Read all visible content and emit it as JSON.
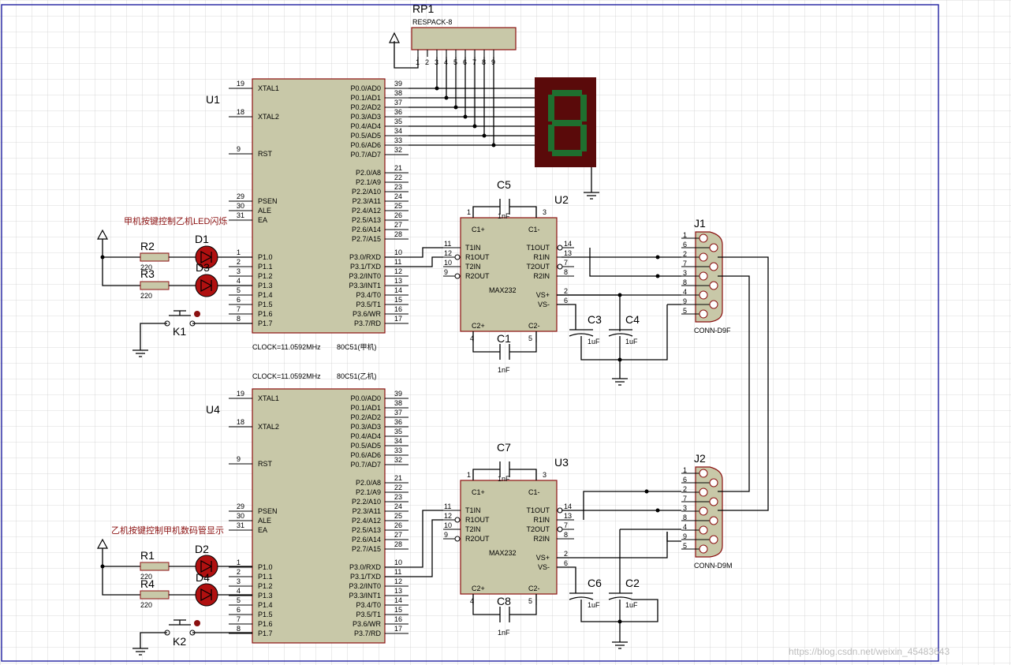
{
  "page": {
    "watermark": "https://blog.csdn.net/weixin_45483643"
  },
  "colors": {
    "grid": "#c8c8c8",
    "chip_fill": "#c8c8a8",
    "chip_border": "#8b1010",
    "wire": "#000000",
    "led_fill": "#b01010",
    "seg_bg": "#5a0a0a",
    "seg_on": "#1f6f2f",
    "note_text": "#8b1010"
  },
  "u1": {
    "ref": "U1",
    "part": "80C51(甲机)",
    "clock": "CLOCK=11.0592MHz",
    "left_pins": [
      {
        "num": "19",
        "name": "XTAL1"
      },
      {
        "num": "18",
        "name": "XTAL2"
      },
      {
        "num": "9",
        "name": "RST"
      },
      {
        "num": "29",
        "name": "PSEN"
      },
      {
        "num": "30",
        "name": "ALE"
      },
      {
        "num": "31",
        "name": "EA"
      },
      {
        "num": "1",
        "name": "P1.0"
      },
      {
        "num": "2",
        "name": "P1.1"
      },
      {
        "num": "3",
        "name": "P1.2"
      },
      {
        "num": "4",
        "name": "P1.3"
      },
      {
        "num": "5",
        "name": "P1.4"
      },
      {
        "num": "6",
        "name": "P1.5"
      },
      {
        "num": "7",
        "name": "P1.6"
      },
      {
        "num": "8",
        "name": "P1.7"
      }
    ],
    "right_pins": [
      {
        "num": "39",
        "name": "P0.0/AD0"
      },
      {
        "num": "38",
        "name": "P0.1/AD1"
      },
      {
        "num": "37",
        "name": "P0.2/AD2"
      },
      {
        "num": "36",
        "name": "P0.3/AD3"
      },
      {
        "num": "35",
        "name": "P0.4/AD4"
      },
      {
        "num": "34",
        "name": "P0.5/AD5"
      },
      {
        "num": "33",
        "name": "P0.6/AD6"
      },
      {
        "num": "32",
        "name": "P0.7/AD7"
      },
      {
        "num": "21",
        "name": "P2.0/A8"
      },
      {
        "num": "22",
        "name": "P2.1/A9"
      },
      {
        "num": "23",
        "name": "P2.2/A10"
      },
      {
        "num": "24",
        "name": "P2.3/A11"
      },
      {
        "num": "25",
        "name": "P2.4/A12"
      },
      {
        "num": "26",
        "name": "P2.5/A13"
      },
      {
        "num": "27",
        "name": "P2.6/A14"
      },
      {
        "num": "28",
        "name": "P2.7/A15"
      },
      {
        "num": "10",
        "name": "P3.0/RXD"
      },
      {
        "num": "11",
        "name": "P3.1/TXD"
      },
      {
        "num": "12",
        "name": "P3.2/INT0"
      },
      {
        "num": "13",
        "name": "P3.3/INT1"
      },
      {
        "num": "14",
        "name": "P3.4/T0"
      },
      {
        "num": "15",
        "name": "P3.5/T1"
      },
      {
        "num": "16",
        "name": "P3.6/WR"
      },
      {
        "num": "17",
        "name": "P3.7/RD"
      }
    ]
  },
  "u4": {
    "ref": "U4",
    "part": "80C51(乙机)",
    "clock": "CLOCK=11.0592MHz"
  },
  "max232": {
    "u2_ref": "U2",
    "u3_ref": "U3",
    "name": "MAX232",
    "pins": [
      {
        "num": "1",
        "name": "C1+"
      },
      {
        "num": "3",
        "name": "C1-"
      },
      {
        "num": "11",
        "name": "T1IN"
      },
      {
        "num": "12",
        "name": "R1OUT"
      },
      {
        "num": "10",
        "name": "T2IN"
      },
      {
        "num": "9",
        "name": "R2OUT"
      },
      {
        "num": "14",
        "name": "T1OUT"
      },
      {
        "num": "13",
        "name": "R1IN"
      },
      {
        "num": "7",
        "name": "T2OUT"
      },
      {
        "num": "8",
        "name": "R2IN"
      },
      {
        "num": "2",
        "name": "VS+"
      },
      {
        "num": "6",
        "name": "VS-"
      },
      {
        "num": "4",
        "name": "C2+"
      },
      {
        "num": "5",
        "name": "C2-"
      }
    ]
  },
  "connectors": {
    "j1_ref": "J1",
    "j1_type": "CONN-D9F",
    "j2_ref": "J2",
    "j2_type": "CONN-D9M",
    "pin_numbers": [
      "1",
      "6",
      "2",
      "7",
      "3",
      "8",
      "4",
      "9",
      "5"
    ]
  },
  "rp1": {
    "ref": "RP1",
    "type": "RESPACK-8",
    "pins": [
      "1",
      "2",
      "3",
      "4",
      "5",
      "6",
      "7",
      "8",
      "9"
    ]
  },
  "components": {
    "c5": {
      "ref": "C5",
      "value": "1nF"
    },
    "c1": {
      "ref": "C1",
      "value": "1nF"
    },
    "c7": {
      "ref": "C7",
      "value": "1nF"
    },
    "c8": {
      "ref": "C8",
      "value": "1nF"
    },
    "c3": {
      "ref": "C3",
      "value": "1uF"
    },
    "c4": {
      "ref": "C4",
      "value": "1uF"
    },
    "c6": {
      "ref": "C6",
      "value": "1uF"
    },
    "c2": {
      "ref": "C2",
      "value": "1uF"
    },
    "r2": {
      "ref": "R2",
      "value": "220"
    },
    "r3": {
      "ref": "R3",
      "value": "220"
    },
    "r1": {
      "ref": "R1",
      "value": "220"
    },
    "r4": {
      "ref": "R4",
      "value": "220"
    },
    "d1": {
      "ref": "D1"
    },
    "d3": {
      "ref": "D3"
    },
    "d2": {
      "ref": "D2"
    },
    "d4": {
      "ref": "D4"
    },
    "k1": {
      "ref": "K1"
    },
    "k2": {
      "ref": "K2"
    }
  },
  "notes": {
    "upper": "甲机按键控制乙机LED闪烁",
    "lower": "乙机按键控制甲机数码管显示"
  }
}
